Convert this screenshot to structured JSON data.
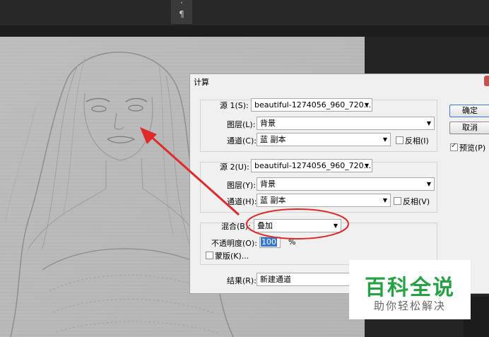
{
  "toolbar": {
    "icon1": "·",
    "icon2": "¶"
  },
  "dialog": {
    "title": "计算",
    "ok_label": "确定",
    "cancel_label": "取消",
    "preview_label": "预览(P)",
    "preview_checked": true,
    "source1": {
      "label": "源 1(S):",
      "file": "beautiful-1274056_960_720....",
      "layer_label": "图层(L):",
      "layer_value": "背景",
      "channel_label": "通道(C):",
      "channel_value": "蓝 副本",
      "invert_label": "反相(I)"
    },
    "source2": {
      "label": "源 2(U):",
      "file": "beautiful-1274056_960_720....",
      "layer_label": "图层(Y):",
      "layer_value": "背景",
      "channel_label": "通道(H):",
      "channel_value": "蓝 副本",
      "invert_label": "反相(V)"
    },
    "blend": {
      "label": "混合(B):",
      "value": "叠加",
      "opacity_label": "不透明度(O):",
      "opacity_value": "100",
      "opacity_unit": "%",
      "mask_label": "蒙版(K)..."
    },
    "result": {
      "label": "结果(R):",
      "value": "新建通道"
    }
  },
  "watermark": {
    "title": "百科全说",
    "subtitle": "助你轻松解决"
  },
  "colors": {
    "annotation_red": "#e02a2a",
    "watermark_green": "#25a244"
  }
}
